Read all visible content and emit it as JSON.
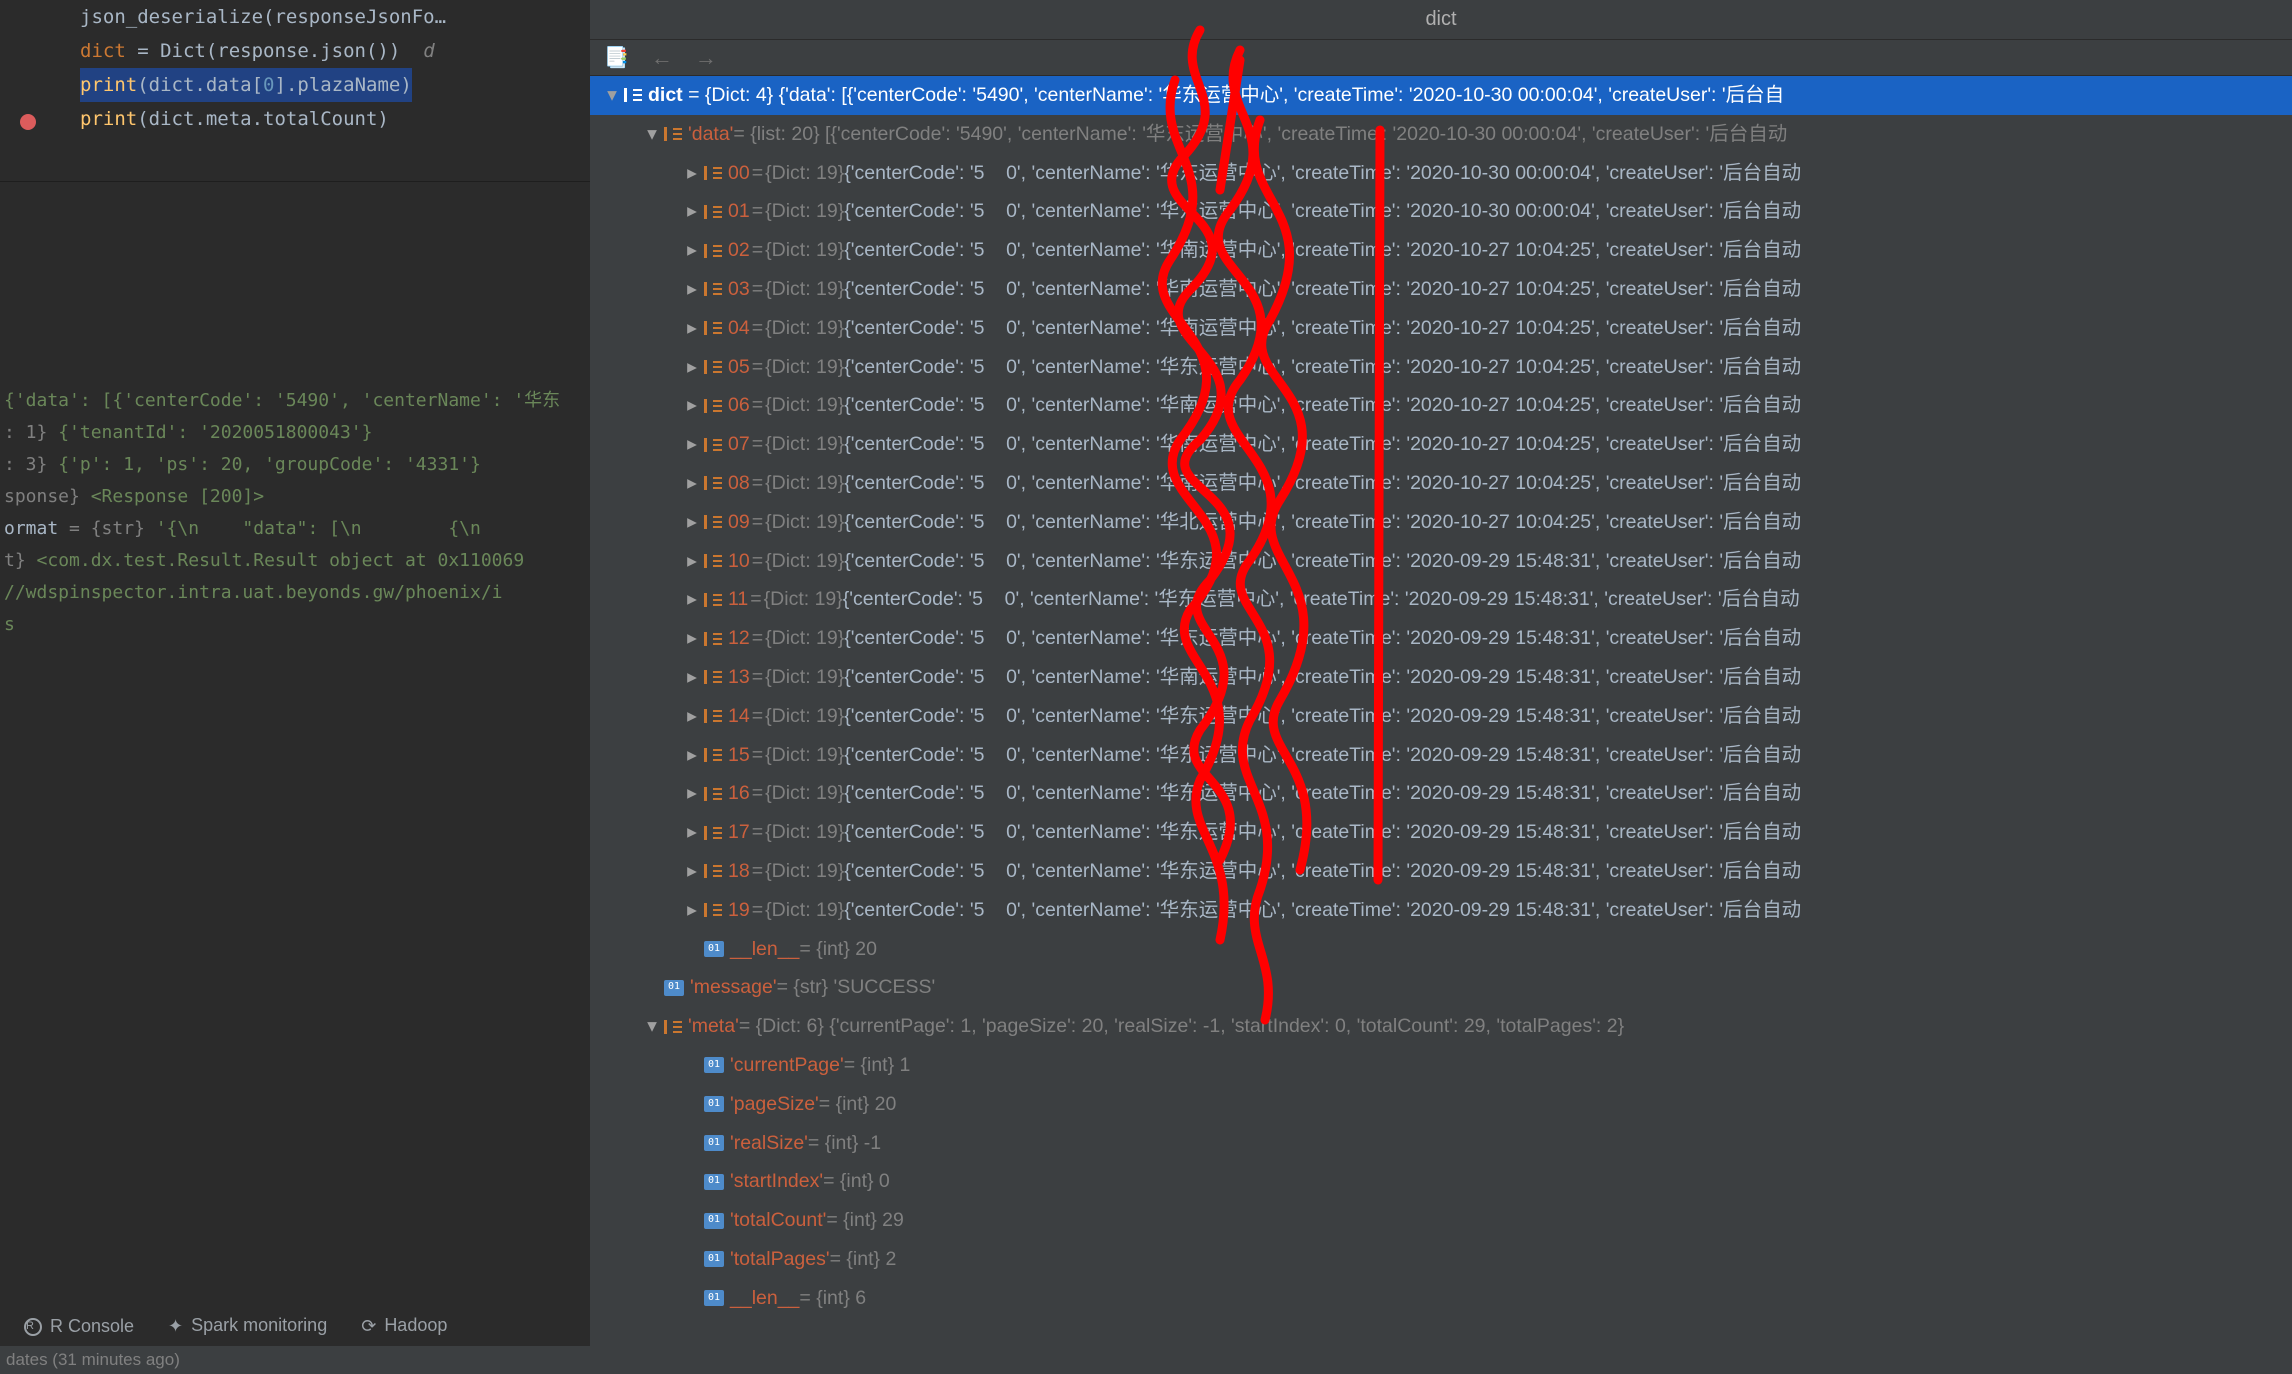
{
  "title": "dict",
  "code": {
    "l1": "json_deserialize(responseJsonFo…",
    "l2": "",
    "l3a": "dict",
    "l3b": " = Dict(response.json())  ",
    "l3c": "d",
    "l4a": "print",
    "l4b": "(dict.data[",
    "l4c": "0",
    "l4d": "].plazaName)",
    "l5a": "print",
    "l5b": "(dict.meta.totalCount)"
  },
  "console": {
    "r1": "{'data': [{'centerCode': '5490', 'centerName': '华东",
    "r2_pre": ": 1} ",
    "r2": "{'tenantId': '2020051800043'}",
    "r3_pre": ": 3} ",
    "r3": "{'p': 1, 'ps': 20, 'groupCode': '4331'}",
    "r4_pre": "sponse} ",
    "r4": "<Response [200]>",
    "r5_pre": "ormat",
    "r5_mid": " = {str} ",
    "r5": "'{\\n    \"data\": [\\n        {\\n            \"ce",
    "r6_pre": "t} ",
    "r6": "<com.dx.test.Result.Result object at 0x110069",
    "r7_pre": "",
    "r7": "//wdspinspector.intra.uat.beyonds.gw/phoenix/i",
    "r8": "s"
  },
  "tabs": {
    "r": "R Console",
    "spark": "Spark monitoring",
    "hadoop": "Hadoop"
  },
  "status": "dates (31 minutes ago)",
  "root_value": " = {Dict: 4} {'data': [{'centerCode': '5490', 'centerName': '华东运营中心', 'createTime': '2020-10-30 00:00:04', 'createUser': '后台自",
  "data_hdr_value": " = {list: 20} [{'centerCode': '5490', 'centerName': '华东运营中心', 'createTime': '2020-10-30 00:00:04', 'createUser': '后台自动",
  "items": [
    {
      "idx": "00",
      "center": "华东运营中心",
      "time": "2020-10-30 00:00:04"
    },
    {
      "idx": "01",
      "center": "华东运营中心",
      "time": "2020-10-30 00:00:04"
    },
    {
      "idx": "02",
      "center": "华南运营中心",
      "time": "2020-10-27 10:04:25"
    },
    {
      "idx": "03",
      "center": "华南运营中心",
      "time": "2020-10-27 10:04:25"
    },
    {
      "idx": "04",
      "center": "华南运营中心",
      "time": "2020-10-27 10:04:25"
    },
    {
      "idx": "05",
      "center": "华东运营中心",
      "time": "2020-10-27 10:04:25"
    },
    {
      "idx": "06",
      "center": "华南运营中心",
      "time": "2020-10-27 10:04:25"
    },
    {
      "idx": "07",
      "center": "华南运营中心",
      "time": "2020-10-27 10:04:25"
    },
    {
      "idx": "08",
      "center": "华南运营中心",
      "time": "2020-10-27 10:04:25"
    },
    {
      "idx": "09",
      "center": "华北运营中心",
      "time": "2020-10-27 10:04:25"
    },
    {
      "idx": "10",
      "center": "华东运营中心",
      "time": "2020-09-29 15:48:31"
    },
    {
      "idx": "11",
      "center": "华东运营中心",
      "time": "2020-09-29 15:48:31"
    },
    {
      "idx": "12",
      "center": "华东运营中心",
      "time": "2020-09-29 15:48:31"
    },
    {
      "idx": "13",
      "center": "华南运营中心",
      "time": "2020-09-29 15:48:31"
    },
    {
      "idx": "14",
      "center": "华东运营中心",
      "time": "2020-09-29 15:48:31"
    },
    {
      "idx": "15",
      "center": "华东运营中心",
      "time": "2020-09-29 15:48:31"
    },
    {
      "idx": "16",
      "center": "华东运营中心",
      "time": "2020-09-29 15:48:31"
    },
    {
      "idx": "17",
      "center": "华东运营中心",
      "time": "2020-09-29 15:48:31"
    },
    {
      "idx": "18",
      "center": "华东运营中心",
      "time": "2020-09-29 15:48:31"
    },
    {
      "idx": "19",
      "center": "华东运营中心",
      "time": "2020-09-29 15:48:31"
    }
  ],
  "len_label": "__len__",
  "len_val": " = {int} 20",
  "message_key": "'message'",
  "message_val": " = {str} 'SUCCESS'",
  "meta_key": "'meta'",
  "meta_val": " = {Dict: 6} {'currentPage': 1, 'pageSize': 20, 'realSize': -1, 'startIndex': 0, 'totalCount': 29, 'totalPages': 2}",
  "meta": [
    {
      "k": "'currentPage'",
      "v": " = {int} 1"
    },
    {
      "k": "'pageSize'",
      "v": " = {int} 20"
    },
    {
      "k": "'realSize'",
      "v": " = {int} -1"
    },
    {
      "k": "'startIndex'",
      "v": " = {int} 0"
    },
    {
      "k": "'totalCount'",
      "v": " = {int} 29"
    },
    {
      "k": "'totalPages'",
      "v": " = {int} 2"
    }
  ],
  "meta_len_k": "__len__",
  "meta_len_v": " = {int} 6"
}
